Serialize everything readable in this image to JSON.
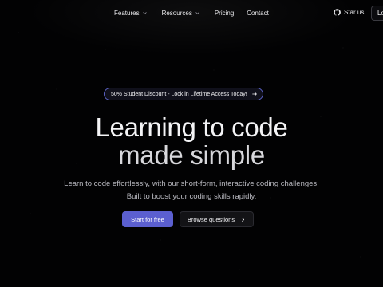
{
  "nav": {
    "links": [
      {
        "label": "Features",
        "has_dropdown": true
      },
      {
        "label": "Resources",
        "has_dropdown": true
      },
      {
        "label": "Pricing",
        "has_dropdown": false
      },
      {
        "label": "Contact",
        "has_dropdown": false
      }
    ],
    "star_label": "Star us",
    "star_icon": "github-icon",
    "login_label": "Lo"
  },
  "hero": {
    "badge_text": "50% Student Discount - Lock in Lifetime Access Today!",
    "badge_icon": "arrow-right-circle-icon",
    "headline_line1": "Learning to code",
    "headline_line2": "made simple",
    "subtext_line1": "Learn to code effortlessly, with our short-form, interactive coding challenges.",
    "subtext_line2": "Built to boost your coding skills rapidly.",
    "cta_primary": "Start for free",
    "cta_secondary": "Browse questions",
    "cta_secondary_icon": "chevron-right-icon"
  },
  "colors": {
    "background": "#020203",
    "accent": "#5b5fd0",
    "badge_border": "#5b62c4"
  }
}
